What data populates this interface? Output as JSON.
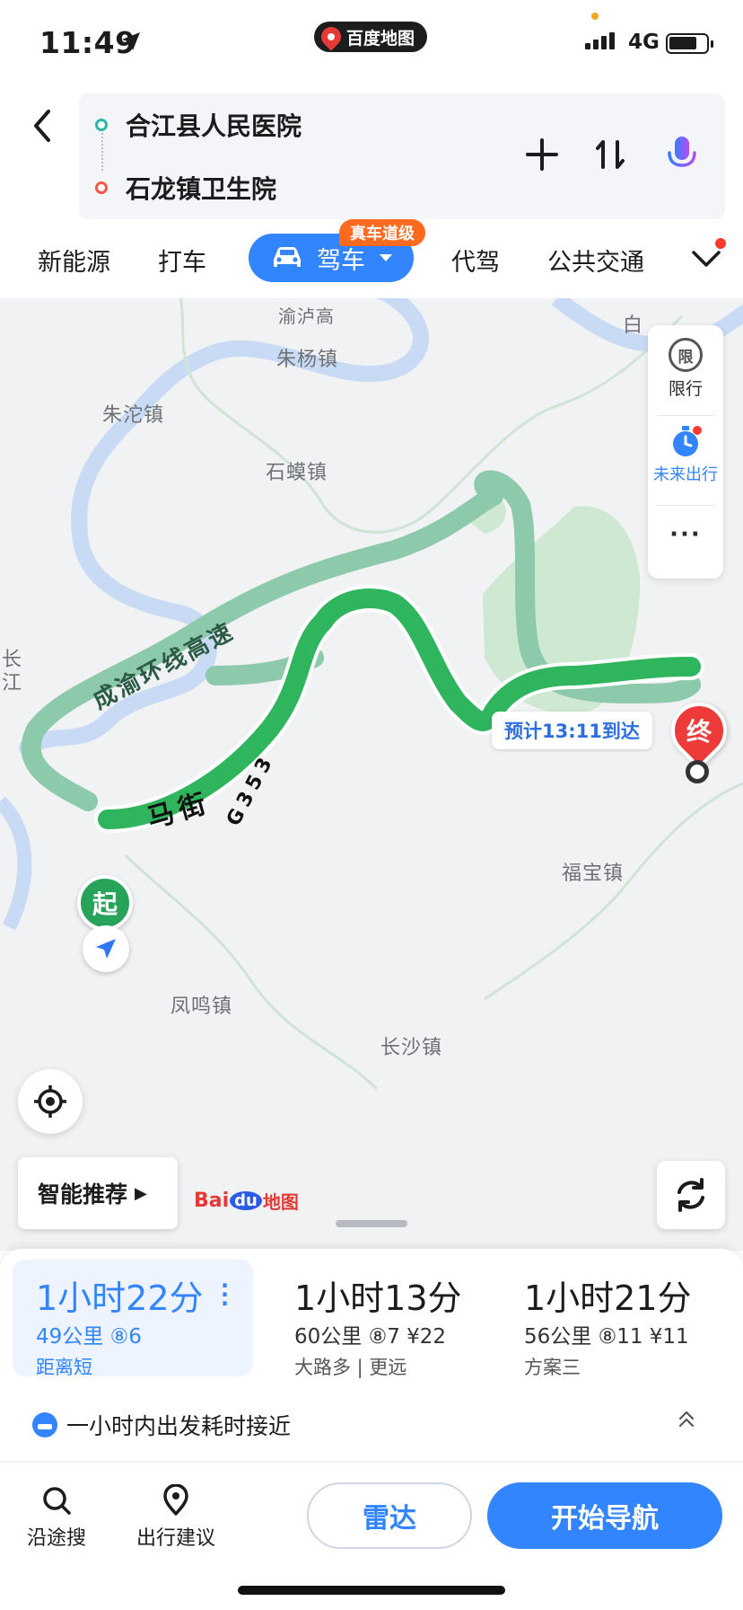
{
  "status_bar": {
    "time": "11:49",
    "app_name": "百度地图",
    "network": "4G"
  },
  "route": {
    "origin": "合江县人民医院",
    "destination": "石龙镇卫生院"
  },
  "header_icons": [
    "plus-icon",
    "swap-icon",
    "microphone-icon"
  ],
  "mode_tabs": {
    "items": [
      "新能源",
      "打车",
      "驾车",
      "代驾",
      "公共交通"
    ],
    "active": "驾车",
    "badge": "真车道级"
  },
  "map": {
    "places": {
      "zhuyang": "朱杨镇",
      "zhutuo": "朱沱镇",
      "shihuang": "石蟆镇",
      "fubao": "福宝镇",
      "fengming": "凤鸣镇",
      "changsha": "长沙镇",
      "bai": "白",
      "changjiang": "长\n江",
      "luhu": "渝泸高"
    },
    "road_labels": {
      "expressway": "成渝环线高速",
      "g353": "G353",
      "street": "马街"
    },
    "side_panel": {
      "restrict_label": "限行",
      "restrict_icon_text": "限",
      "future_label": "未来出行",
      "more": "···"
    },
    "eta": "预计13:11到达",
    "start_label": "起",
    "end_label": "终",
    "smart_recommend": "智能推荐",
    "logo_text": "Bai",
    "logo_du": "du",
    "logo_map": "地图",
    "colors": {
      "route_main": "#2fb55e",
      "route_alt": "#8dc9ab",
      "river": "#c8daf4",
      "park": "#cfe8d2",
      "accent": "#3385ff",
      "end_marker": "#ef3a3a"
    }
  },
  "routes": [
    {
      "duration": "1小时22分",
      "meta": "49公里 ⑧6",
      "tag": "距离短"
    },
    {
      "duration": "1小时13分",
      "meta": "60公里 ⑧7 ¥22",
      "tag": "大路多 | 更远"
    },
    {
      "duration": "1小时21分",
      "meta": "56公里 ⑧11 ¥11",
      "tag": "方案三"
    }
  ],
  "hint": "一小时内出发耗时接近",
  "bottom_bar": {
    "along_search": "沿途搜",
    "travel_advice": "出行建议",
    "radar": "雷达",
    "start_nav": "开始导航"
  }
}
